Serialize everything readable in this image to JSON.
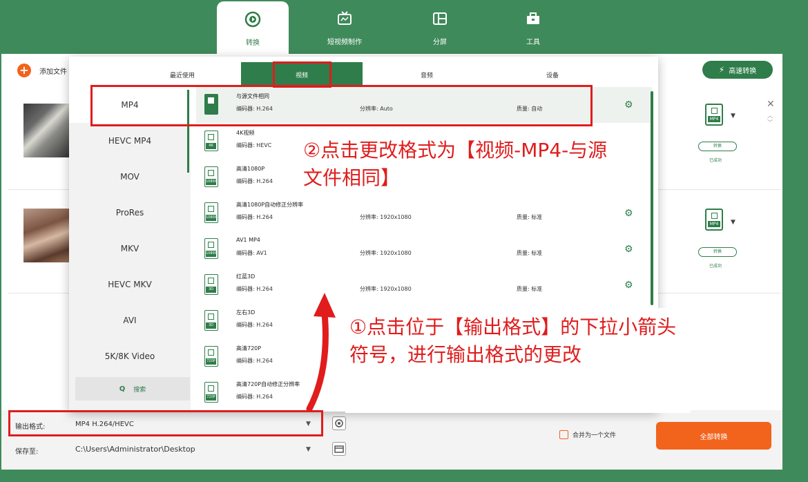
{
  "nav": {
    "tabs": [
      {
        "label": "转换",
        "icon": "convert-icon",
        "active": true
      },
      {
        "label": "短视频制作",
        "icon": "tv-icon",
        "active": false
      },
      {
        "label": "分屏",
        "icon": "split-screen-icon",
        "active": false
      },
      {
        "label": "工具",
        "icon": "toolbox-icon",
        "active": false
      }
    ]
  },
  "toolbar": {
    "add_file": "添加文件",
    "add_icon": "+",
    "speed_convert": "高速转换"
  },
  "panel": {
    "tabs": [
      "最近使用",
      "视频",
      "音频",
      "设备"
    ],
    "categories": [
      "MP4",
      "HEVC MP4",
      "MOV",
      "ProRes",
      "MKV",
      "HEVC MKV",
      "AVI",
      "5K/8K Video"
    ],
    "search": "搜索",
    "search_icon": "Q",
    "formats": [
      {
        "name": "与源文件相同",
        "badge": "",
        "encoder": "编码器:  H.264",
        "resolution": "分辨率:  Auto",
        "quality": "质量:  自动"
      },
      {
        "name": "4K视频",
        "badge": "4K",
        "encoder": "编码器:  HEVC",
        "resolution": "",
        "quality": ""
      },
      {
        "name": "高清1080P",
        "badge": "1080P",
        "encoder": "编码器:  H.264",
        "resolution": "",
        "quality": ""
      },
      {
        "name": "高清1080P自动修正分辨率",
        "badge": "1080P",
        "encoder": "编码器:  H.264",
        "resolution": "分辨率:  1920x1080",
        "quality": "质量:  标准"
      },
      {
        "name": "AV1 MP4",
        "badge": "1080P",
        "encoder": "编码器:  AV1",
        "resolution": "分辨率:  1920x1080",
        "quality": "质量:  标准"
      },
      {
        "name": "红蓝3D",
        "badge": "3D",
        "encoder": "编码器:  H.264",
        "resolution": "分辨率:  1920x1080",
        "quality": "质量:  标准"
      },
      {
        "name": "左右3D",
        "badge": "3D",
        "encoder": "编码器:  H.264",
        "resolution": "",
        "quality": ""
      },
      {
        "name": "高清720P",
        "badge": "720P",
        "encoder": "编码器:  H.264",
        "resolution": "",
        "quality": ""
      },
      {
        "name": "高清720P自动修正分辨率",
        "badge": "720P",
        "encoder": "编码器:  H.264",
        "resolution": "",
        "quality": ""
      }
    ]
  },
  "file_items": [
    {
      "format_badge": "MP4",
      "convert_label": "转换",
      "status": "已成功"
    },
    {
      "format_badge": "MP4",
      "convert_label": "转换",
      "status": "已成功"
    }
  ],
  "bottom": {
    "output_label": "输出格式:",
    "output_value": "MP4 H.264/HEVC",
    "save_label": "保存至:",
    "save_path": "C:\\Users\\Administrator\\Desktop",
    "merge_label": "合并为一个文件",
    "convert_all": "全部转换"
  },
  "annotations": {
    "note2": "②点击更改格式为【视频-MP4-与源文件相同】",
    "note1": "①点击位于【输出格式】的下拉小箭头符号，进行输出格式的更改"
  },
  "colors": {
    "brand_green": "#3f8a5a",
    "accent_orange": "#f2631c",
    "annotation_red": "#e01c1c"
  }
}
